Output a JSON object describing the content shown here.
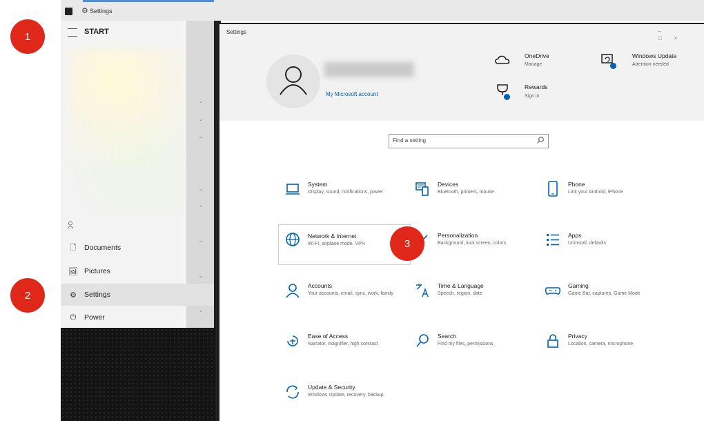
{
  "taskbar": {
    "title": "Settings",
    "gear_glyph": "⚙"
  },
  "start_menu": {
    "label": "START",
    "items": [
      {
        "label": "Documents",
        "icon": "document-icon",
        "glyph": "🗋"
      },
      {
        "label": "Pictures",
        "icon": "pictures-icon",
        "glyph": "🖼"
      },
      {
        "label": "Settings",
        "icon": "gear-icon",
        "glyph": "⚙"
      },
      {
        "label": "Power",
        "icon": "power-icon",
        "glyph": "⏻"
      }
    ],
    "chevron_glyph": "⌄"
  },
  "settings": {
    "title": "Settings",
    "controls": "–□×",
    "account_link": "My Microsoft account",
    "onedrive": {
      "title": "OneDrive",
      "sub": "Manage"
    },
    "windows_update": {
      "title": "Windows Update",
      "sub": "Attention needed"
    },
    "rewards": {
      "title": "Rewards",
      "sub": "Sign in"
    },
    "search_placeholder": "Find a setting",
    "tiles": [
      {
        "title": "System",
        "sub": "Display, sound, notifications, power",
        "icon": "laptop-icon"
      },
      {
        "title": "Devices",
        "sub": "Bluetooth, printers, mouse",
        "icon": "keyboard-icon"
      },
      {
        "title": "Phone",
        "sub": "Link your Android, iPhone",
        "icon": "phone-icon"
      },
      {
        "title": "Network & Internet",
        "sub": "Wi-Fi, airplane mode, VPN",
        "icon": "globe-icon"
      },
      {
        "title": "Personalization",
        "sub": "Background, lock screen, colors",
        "icon": "brush-icon"
      },
      {
        "title": "Apps",
        "sub": "Uninstall, defaults",
        "icon": "apps-list-icon"
      },
      {
        "title": "Accounts",
        "sub": "Your accounts, email, sync, work, family",
        "icon": "person-icon"
      },
      {
        "title": "Time & Language",
        "sub": "Speech, region, date",
        "icon": "time-language-icon"
      },
      {
        "title": "Gaming",
        "sub": "Game Bar, captures, Game Mode",
        "icon": "gamepad-icon"
      },
      {
        "title": "Ease of Access",
        "sub": "Narrator, magnifier, high contrast",
        "icon": "ease-of-access-icon"
      },
      {
        "title": "Search",
        "sub": "Find my files, permissions",
        "icon": "search-icon"
      },
      {
        "title": "Privacy",
        "sub": "Location, camera, microphone",
        "icon": "lock-icon"
      },
      {
        "title": "Update & Security",
        "sub": "Windows Update, recovery, backup",
        "icon": "sync-icon"
      }
    ]
  },
  "callouts": [
    "1",
    "2",
    "3"
  ],
  "colors": {
    "accent": "#0063b1",
    "callout": "#e0281a"
  }
}
